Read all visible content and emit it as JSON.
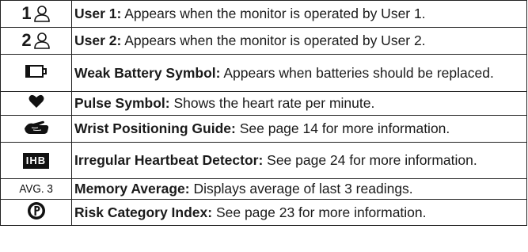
{
  "rows": [
    {
      "icon": "user-1-icon",
      "symbol_text": "1",
      "title": "User 1:",
      "text": " Appears when the monitor is operated by User 1."
    },
    {
      "icon": "user-2-icon",
      "symbol_text": "2",
      "title": "User 2:",
      "text": " Appears when the monitor is operated by User 2."
    },
    {
      "icon": "weak-battery-icon",
      "title": "Weak Battery Symbol:",
      "text": " Appears when batteries should be replaced."
    },
    {
      "icon": "heart-icon",
      "title": "Pulse Symbol:",
      "text": " Shows the heart rate per minute."
    },
    {
      "icon": "wrist-positioning-icon",
      "title": "Wrist Positioning Guide:",
      "text": " See page 14 for more information."
    },
    {
      "icon": "ihb-icon",
      "symbol_text": "IHB",
      "title": "Irregular Heartbeat Detector:",
      "text": " See page 24 for more information."
    },
    {
      "icon": "memory-average-icon",
      "symbol_text": "AVG. 3",
      "title": "Memory Average:",
      "text": " Displays average of last 3 readings."
    },
    {
      "icon": "risk-category-icon",
      "title": "Risk Category Index:",
      "text": " See page 23 for more information."
    }
  ]
}
